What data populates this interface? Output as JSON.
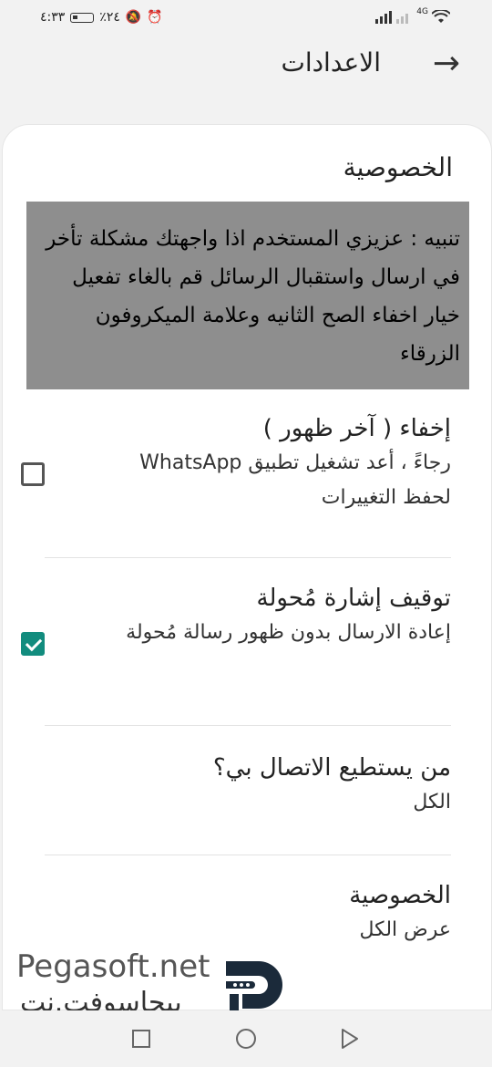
{
  "status_bar": {
    "time": "٤:٣٣",
    "battery": "٪٢٤",
    "network": "4G"
  },
  "header": {
    "title": "الاعدادات"
  },
  "privacy_section": {
    "title": "الخصوصية"
  },
  "warning": {
    "text": "تنبيه : عزيزي المستخدم اذا واجهتك مشكلة تأخر في ارسال واستقبال الرسائل قم بالغاء تفعيل خيار اخفاء الصح الثانيه وعلامة الميكروفون الزرقاء"
  },
  "settings": {
    "hide_last_seen": {
      "title": "إخفاء ( آخر ظهور )",
      "description": "رجاءً ، أعد تشغيل تطبيق WhatsApp لحفظ التغييرات",
      "checked": false
    },
    "stop_forwarded": {
      "title": "توقيف إشارة مُحولة",
      "description": "إعادة الارسال بدون ظهور رسالة مُحولة",
      "checked": true
    },
    "who_can_call": {
      "title": "من يستطيع الاتصال بي؟",
      "value": "الكل"
    },
    "privacy": {
      "title": "الخصوصية",
      "value": "عرض الكل"
    }
  },
  "watermark": {
    "english": "Pegasoft.net",
    "arabic": "بيجاسوفت.نت"
  },
  "colors": {
    "accent": "#128c7e",
    "warning_bg": "#8e8e8e"
  }
}
